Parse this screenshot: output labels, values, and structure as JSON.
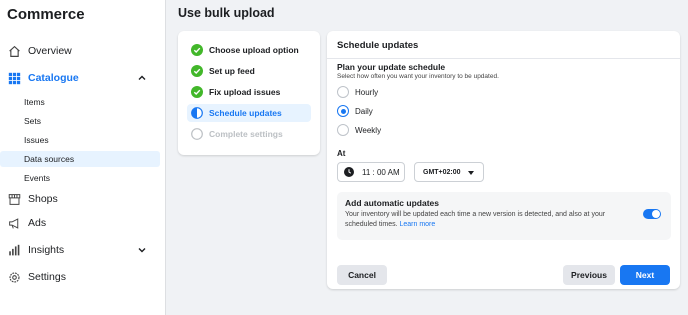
{
  "app": {
    "title": "Commerce"
  },
  "sidebar": {
    "items": [
      {
        "label": "Overview",
        "icon": "home-icon"
      },
      {
        "label": "Catalogue",
        "icon": "grid-icon",
        "active": true,
        "expanded": true
      },
      {
        "label": "Shops",
        "icon": "shop-icon"
      },
      {
        "label": "Ads",
        "icon": "megaphone-icon"
      },
      {
        "label": "Insights",
        "icon": "bar-chart-icon"
      },
      {
        "label": "Settings",
        "icon": "gear-icon"
      }
    ],
    "catalogue_sub": [
      {
        "label": "Items"
      },
      {
        "label": "Sets"
      },
      {
        "label": "Issues"
      },
      {
        "label": "Data sources",
        "selected": true
      },
      {
        "label": "Events"
      }
    ]
  },
  "main": {
    "title": "Use bulk upload",
    "steps": [
      {
        "label": "Choose upload option",
        "status": "done"
      },
      {
        "label": "Set up feed",
        "status": "done"
      },
      {
        "label": "Fix upload issues",
        "status": "done"
      },
      {
        "label": "Schedule updates",
        "status": "current"
      },
      {
        "label": "Complete settings",
        "status": "pending"
      }
    ],
    "card": {
      "title": "Schedule updates",
      "section_title": "Plan your update schedule",
      "section_subtitle": "Select how often you want your inventory to be updated.",
      "frequency_options": [
        {
          "label": "Hourly",
          "checked": false
        },
        {
          "label": "Daily",
          "checked": true
        },
        {
          "label": "Weekly",
          "checked": false
        }
      ],
      "at_label": "At",
      "time_value": "11 : 00 AM",
      "timezone_value": "GMT+02:00",
      "auto_updates": {
        "title": "Add automatic updates",
        "description": "Your inventory will be updated each time a new version is detected, and also at your scheduled times.",
        "link": "Learn more",
        "enabled": true
      },
      "buttons": {
        "cancel": "Cancel",
        "previous": "Previous",
        "next": "Next"
      }
    }
  },
  "colors": {
    "accent": "#1877f2",
    "success": "#42b72a",
    "selected_bg": "#e7f3ff"
  }
}
